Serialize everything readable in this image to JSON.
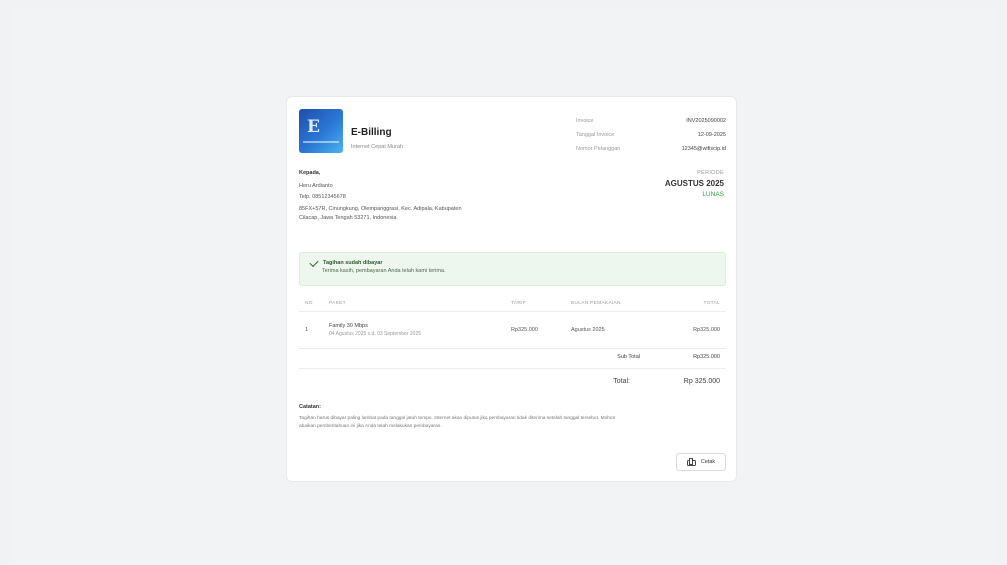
{
  "brand": {
    "name": "E-Billing",
    "tagline": "Internet Cepat Murah",
    "logo_icon": "e-billing-logo"
  },
  "meta": {
    "invoice_label": "Invoice",
    "invoice_value": "INV2025090002",
    "date_label": "Tanggal Invoice",
    "date_value": "12-09-2025",
    "customer_label": "Nomor Pelanggan",
    "customer_value": "12345@wifiscip.id"
  },
  "recipient": {
    "label": "Kepada,",
    "name": "Heru Ardianto",
    "phone": "Telp. 08512345678",
    "address_line1": "85FX+57R, Cinungkung, Olempanggrasi, Kec. Adipala, Kabupaten",
    "address_line2": "Cilacap, Jawa Tengah 53271, Indonesia"
  },
  "period": {
    "label": "PERIODE",
    "value": "AGUSTUS 2025",
    "status": "LUNAS",
    "status_color": "#2f9e44"
  },
  "alert": {
    "icon": "check-icon",
    "title": "Tagihan sudah dibayar",
    "text": "Terima kasih, pembayaran Anda telah kami terima."
  },
  "table": {
    "headers": {
      "no": "NO",
      "paket": "PAKET",
      "tarif": "TARIF",
      "bulan": "BULAN PEMAKAIAN",
      "total": "TOTAL"
    },
    "rows": [
      {
        "no": "1",
        "paket_name": "Family 30 Mbps",
        "paket_range": "04 Agustus 2025 s.d. 03 September 2025",
        "tarif": "Rp325.000",
        "bulan": "Agustus 2025",
        "total": "Rp325.000"
      }
    ]
  },
  "summary": {
    "subtotal_label": "Sub Total",
    "subtotal_value": "Rp325.000",
    "total_label": "Total:",
    "total_value": "Rp 325.000"
  },
  "notes": {
    "title": "Catatan:",
    "text": "Tagihan harus dibayar paling lambat pada tanggal jatuh tempo. Internet akan diputus jika pembayaran tidak diterima setelah tanggal tersebut. Mohon abaikan pemberitahuan ini jika Anda telah melakukan pembayaran."
  },
  "actions": {
    "print_label": "Cetak",
    "print_icon": "printer-icon"
  },
  "colors": {
    "page_bg": "#f1f2f4",
    "card_bg": "#ffffff",
    "alert_bg": "#eef7ee",
    "accent": "#2b78d6"
  }
}
